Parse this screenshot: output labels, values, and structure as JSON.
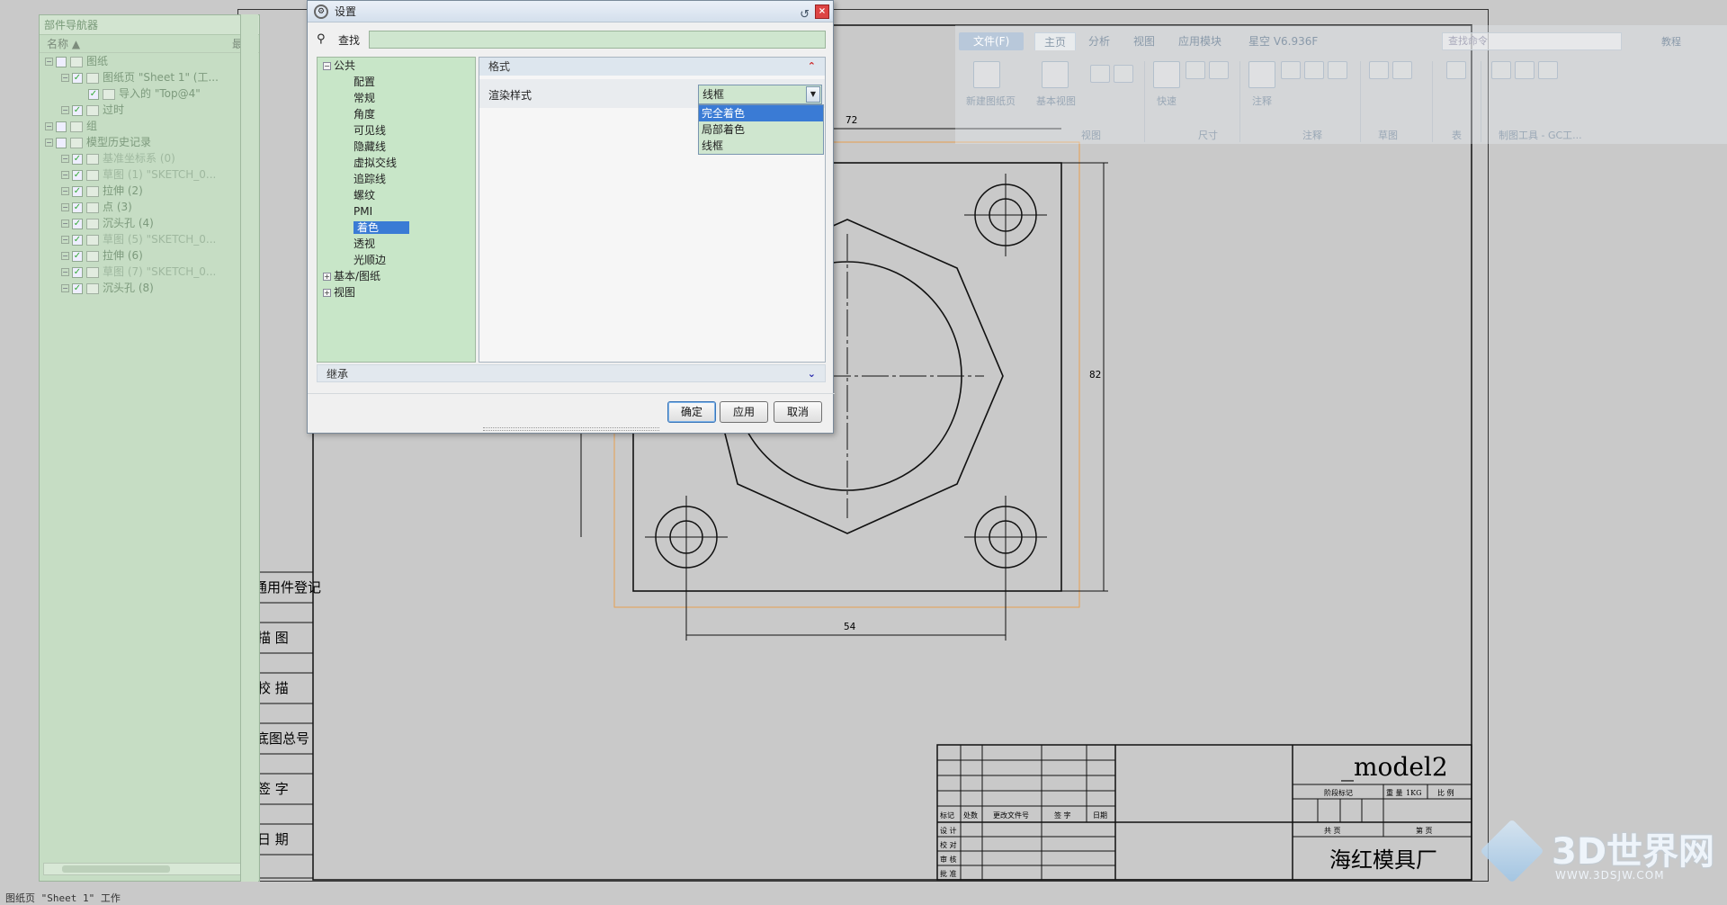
{
  "navigator": {
    "title": "部件导航器",
    "col_name": "名称",
    "col_latest": "最新",
    "rows": [
      {
        "label": "图纸",
        "level": 0,
        "ok": true
      },
      {
        "label": "图纸页 \"Sheet 1\" (工...",
        "level": 1,
        "ok": true
      },
      {
        "label": "导入的 \"Top@4\"",
        "level": 2,
        "ok": true
      },
      {
        "label": "过时",
        "level": 1,
        "ok": false
      },
      {
        "label": "组",
        "level": 0,
        "ok": false
      },
      {
        "label": "模型历史记录",
        "level": 0,
        "ok": false
      },
      {
        "label": "基准坐标系 (0)",
        "level": 1,
        "ok": true,
        "dim": true
      },
      {
        "label": "草图 (1) \"SKETCH_0...",
        "level": 1,
        "ok": true,
        "dim": true
      },
      {
        "label": "拉伸 (2)",
        "level": 1,
        "ok": true
      },
      {
        "label": "点 (3)",
        "level": 1,
        "ok": true
      },
      {
        "label": "沉头孔 (4)",
        "level": 1,
        "ok": true
      },
      {
        "label": "草图 (5) \"SKETCH_0...",
        "level": 1,
        "ok": true,
        "dim": true
      },
      {
        "label": "拉伸 (6)",
        "level": 1,
        "ok": true
      },
      {
        "label": "草图 (7) \"SKETCH_0...",
        "level": 1,
        "ok": true,
        "dim": true
      },
      {
        "label": "沉头孔 (8)",
        "level": 1,
        "ok": true
      }
    ]
  },
  "status_bar": "图纸页 \"Sheet 1\" 工作",
  "dialog": {
    "title": "设置",
    "find_label": "查找",
    "find_value": "",
    "tree": {
      "public": "公共",
      "items": [
        "配置",
        "常规",
        "角度",
        "可见线",
        "隐藏线",
        "虚拟交线",
        "追踪线",
        "螺纹",
        "PMI",
        "着色",
        "透视",
        "光顺边"
      ],
      "selected_index": 9,
      "basic": "基本/图纸",
      "view": "视图"
    },
    "format_header": "格式",
    "render_label": "渲染样式",
    "render_value": "线框",
    "dropdown_options": [
      "完全着色",
      "局部着色",
      "线框"
    ],
    "dropdown_highlight": 0,
    "inherit_header": "继承",
    "buttons": {
      "ok": "确定",
      "apply": "应用",
      "cancel": "取消"
    }
  },
  "ribbon": {
    "tabs": [
      "文件(F)",
      "主页",
      "分析",
      "视图",
      "应用模块",
      "星空 V6.936F"
    ],
    "active_tab": "主页",
    "search_placeholder": "查找命令",
    "tutorial": "教程",
    "buttons": {
      "new_sheet": "新建图纸页",
      "base_view": "基本视图",
      "quick": "快速",
      "note": "注释"
    },
    "groups": [
      "视图",
      "尺寸",
      "注释",
      "草图",
      "表",
      "制图工具 - GC工..."
    ]
  },
  "drawing": {
    "dim_top": "72",
    "dim_right": "82",
    "dim_bottom": "54",
    "left_block": [
      "借通用件登记",
      "描 图",
      "校 描",
      "旧底图总号",
      "签 字",
      "日 期"
    ],
    "title_block": {
      "part_name": "_model2",
      "company": "海红模具厂",
      "revision_headers": [
        "标记",
        "处数",
        "更改文件号",
        "签 字",
        "日期"
      ],
      "role_labels": [
        "设 计",
        "校 对",
        "审 核",
        "批 准"
      ],
      "stage_label": "阶段标记",
      "weight_label": "重 量",
      "weight_value": "1KG",
      "scale_label": "比 例",
      "sheets_total": "共 页",
      "sheet_no": "第 页"
    }
  },
  "watermark": {
    "logo_text": "3D世界网",
    "url": "WWW.3DSJW.COM"
  },
  "colors": {
    "navigator_bg": "#c6ddc4",
    "selection": "#3a7bd5",
    "view_border": "#e8a050",
    "ok_green": "#4bb04b"
  }
}
